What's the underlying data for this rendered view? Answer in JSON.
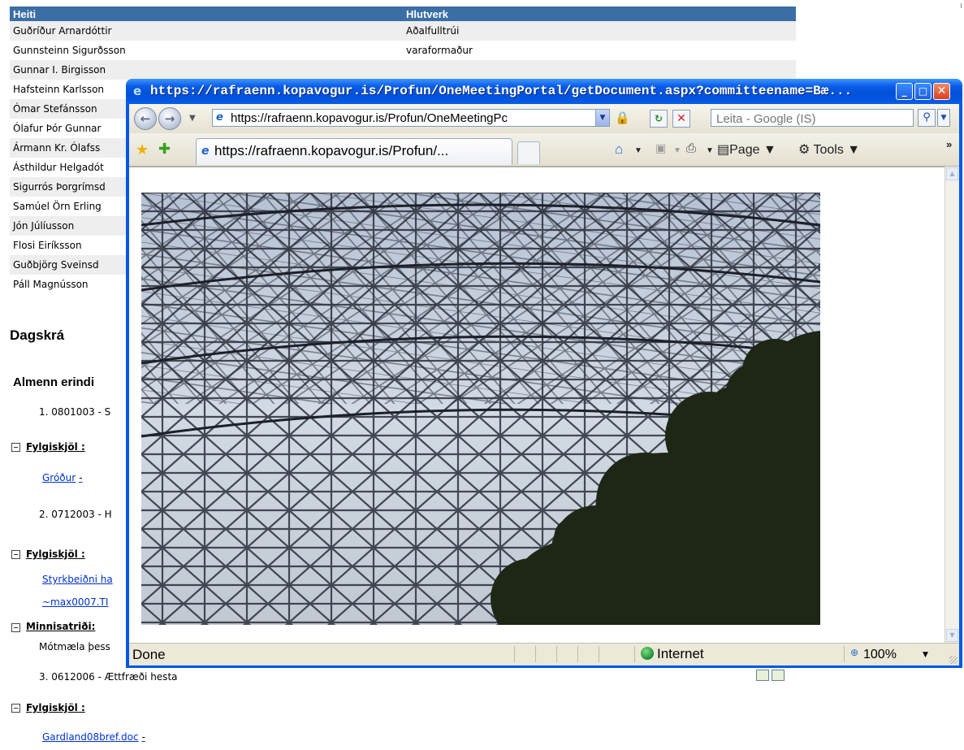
{
  "members": {
    "headers": [
      "Heiti",
      "Hlutverk"
    ],
    "rows": [
      {
        "name": "Guðríður Arnardóttir",
        "role": "Aðalfulltrúi"
      },
      {
        "name": "Gunnsteinn Sigurðsson",
        "role": "varaformaður"
      },
      {
        "name": "Gunnar I. Birgisson",
        "role": ""
      },
      {
        "name": "Hafsteinn Karlsson",
        "role": ""
      },
      {
        "name": "Ómar Stefánsson",
        "role": ""
      },
      {
        "name": "Ólafur Þór Gunnar",
        "role": ""
      },
      {
        "name": "Ármann Kr. Ólafss",
        "role": ""
      },
      {
        "name": "Ásthildur Helgadót",
        "role": ""
      },
      {
        "name": "Sigurrós Þorgrímsd",
        "role": ""
      },
      {
        "name": "Samúel Örn Erling",
        "role": ""
      },
      {
        "name": "Jón Júlíusson",
        "role": ""
      },
      {
        "name": "Flosi Eiríksson",
        "role": ""
      },
      {
        "name": "Guðbjörg Sveinsd",
        "role": ""
      },
      {
        "name": "Páll Magnússon",
        "role": ""
      }
    ]
  },
  "agenda": {
    "title": "Dagskrá",
    "section": "Almenn erindi",
    "item1": "1. 0801003 - S",
    "attachments_label": "Fylgiskjöl :",
    "att1": "Gróður",
    "dash": "-",
    "item2": "2. 0712003 - H",
    "att2a": "Styrkbeiðni ha",
    "att2b": "~max0007.TI",
    "notes_label": "Minnisatriði:",
    "notes_text": "Mótmæla þess",
    "item3": "3. 0612006 - Ættfræði hesta",
    "att3": "Gardland08bref.doc"
  },
  "ie": {
    "title": "https://rafraenn.kopavogur.is/Profun/OneMeetingPortal/getDocument.aspx?committeename=Bæ...",
    "address": "https://rafraenn.kopavogur.is/Profun/OneMeetingPc",
    "search_placeholder": "Leita - Google (IS)",
    "tab_title": "https://rafraenn.kopavogur.is/Profun/...",
    "page_label": "Page",
    "tools_label": "Tools",
    "status": "Done",
    "zone": "Internet",
    "zoom": "100%"
  },
  "colors": {
    "table_header": "#3a6ea5",
    "link": "#0033cc",
    "title_bar": "#0058e6"
  }
}
